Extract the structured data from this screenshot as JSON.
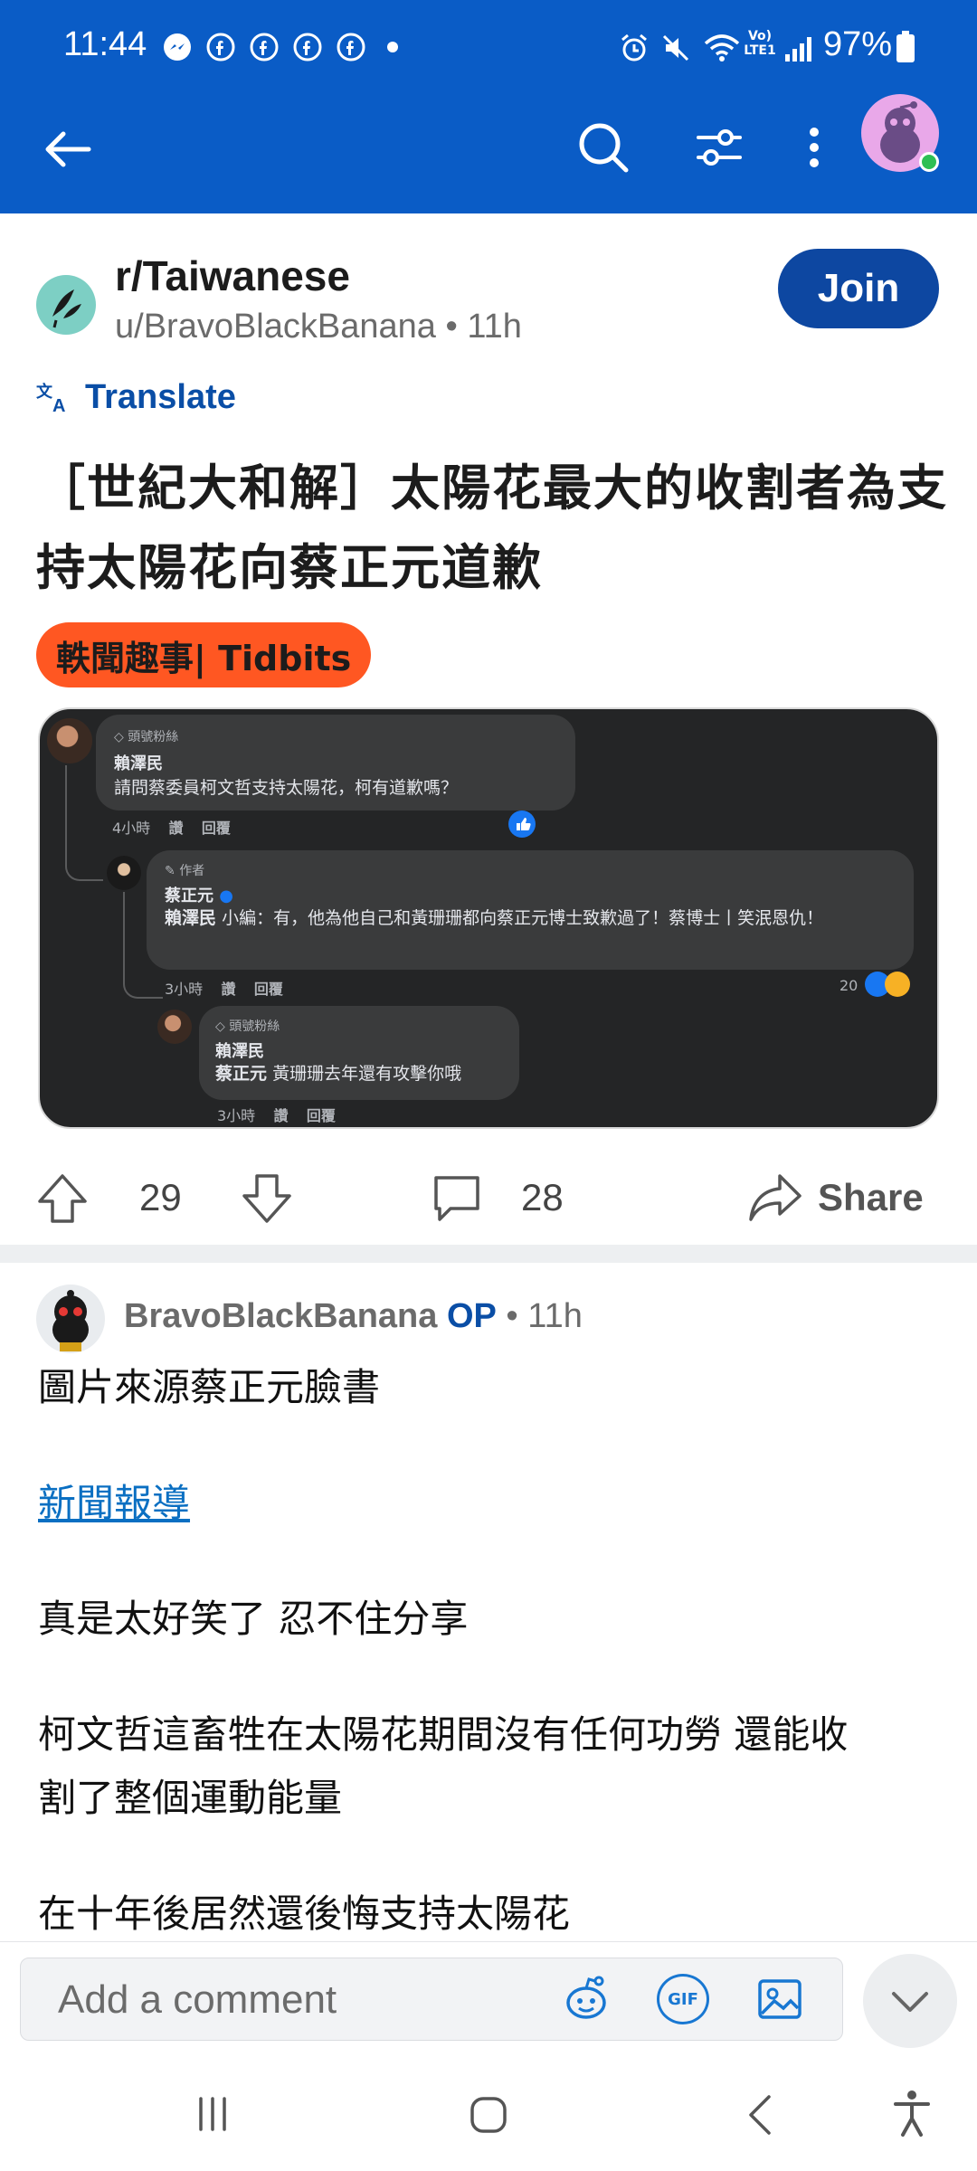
{
  "status_bar": {
    "time": "11:44",
    "battery": "97%",
    "notification_icons": [
      "messenger-icon",
      "facebook-icon",
      "facebook-icon",
      "facebook-icon",
      "facebook-icon"
    ],
    "system_icons": [
      "alarm-icon",
      "mute-icon",
      "wifi-icon",
      "volte-icon",
      "signal-icon",
      "battery-icon"
    ],
    "volte_label": "Vo) LTE1"
  },
  "header": {
    "icons": [
      "back-arrow-icon",
      "search-icon",
      "filter-icon",
      "more-vertical-icon",
      "user-avatar"
    ]
  },
  "post": {
    "subreddit": "r/Taiwanese",
    "meta": "u/BravoBlackBanana • 11h",
    "join_label": "Join",
    "translate_label": "Translate",
    "title": "［世紀大和解］太陽花最大的收割者為支持太陽花向蔡正元道歉",
    "flair": "軼聞趣事| Tidbits",
    "upvotes": "29",
    "comments": "28",
    "share_label": "Share"
  },
  "embedded_image": {
    "c1": {
      "badge": "頭號粉絲",
      "name": "賴澤民",
      "text": "請問蔡委員柯文哲支持太陽花，柯有道歉嗎？",
      "time": "4小時",
      "like": "讚",
      "reply": "回覆"
    },
    "c2": {
      "badge": "作者",
      "name": "蔡正元",
      "mention": "賴澤民",
      "text": "小編：有，他為他自己和黃珊珊都向蔡正元博士致歉過了！蔡博士丨笑泯恩仇！",
      "time": "3小時",
      "like": "讚",
      "reply": "回覆",
      "reactions": "20"
    },
    "c3": {
      "badge": "頭號粉絲",
      "name": "賴澤民",
      "mention": "蔡正元",
      "text": "黃珊珊去年還有攻擊你哦",
      "time": "3小時",
      "like": "讚",
      "reply": "回覆"
    }
  },
  "comment": {
    "author": "BravoBlackBanana",
    "op_tag": "OP",
    "age": "• 11h",
    "lines": [
      "圖片來源蔡正元臉書",
      "新聞報導",
      "真是太好笑了 忍不住分享",
      "柯文哲這畜牲在太陽花期間沒有任何功勞 還能收",
      "割了整個運動能量",
      "在十年後居然還後悔支持太陽花"
    ]
  },
  "comment_bar": {
    "placeholder": "Add a comment",
    "gif_label": "GIF",
    "icons": [
      "snoo-emoji-icon",
      "gif-icon",
      "image-icon",
      "chevron-down-icon"
    ]
  },
  "nav_bar": {
    "icons": [
      "recents-icon",
      "home-icon",
      "back-icon",
      "accessibility-icon"
    ]
  },
  "colors": {
    "header_blue": "#0a5cc6",
    "join_blue": "#0d47a1",
    "flair_orange": "#ff5722",
    "link_blue": "#0a6fc2"
  }
}
